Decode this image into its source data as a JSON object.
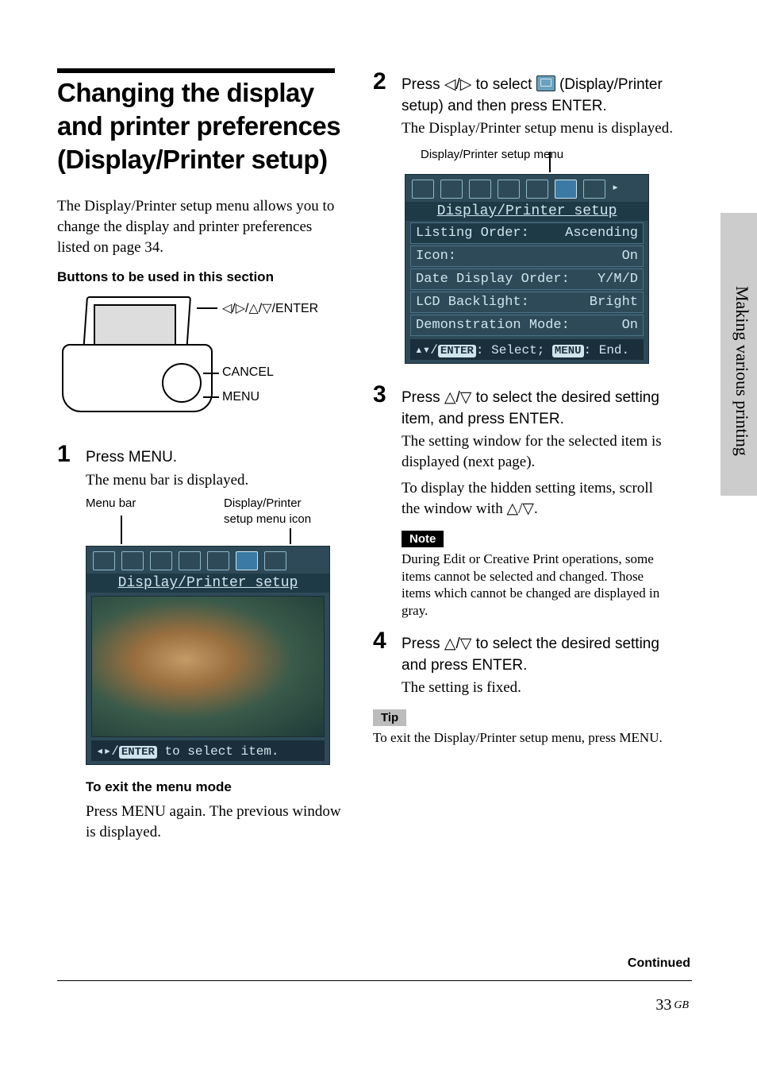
{
  "sideLabel": "Making various printing",
  "title": "Changing the display and printer preferences (Display/Printer setup)",
  "intro": "The Display/Printer setup menu allows you to change the display and printer preferences listed on page 34.",
  "buttonsHeading": "Buttons to be used in this section",
  "deviceLabels": {
    "arrows": "◁/▷/△/▽/ENTER",
    "cancel": "CANCEL",
    "menu": "MENU"
  },
  "step1": {
    "num": "1",
    "lead": "Press MENU.",
    "follow": "The menu bar is displayed.",
    "labelMenuBar": "Menu bar",
    "labelIcon": "Display/Printer setup menu icon",
    "lcdTitle": "Display/Printer setup",
    "lcdHintPrefix": "◂▸/",
    "lcdHintEnter": "ENTER",
    "lcdHintSuffix": " to select item."
  },
  "exitHeading": "To exit the menu mode",
  "exitBody": "Press MENU again.  The previous window is displayed.",
  "step2": {
    "num": "2",
    "leadA": "Press ◁/▷ to select ",
    "leadB": " (Display/Printer setup) and then press ENTER.",
    "follow": "The Display/Printer setup  menu is displayed.",
    "caption": "Display/Printer setup menu",
    "lcdTitle": "Display/Printer setup",
    "rows": [
      {
        "label": "Listing Order:",
        "value": "Ascending",
        "sel": true
      },
      {
        "label": "Icon:",
        "value": "On",
        "sel": false
      },
      {
        "label": "Date Display Order:",
        "value": "Y/M/D",
        "sel": false
      },
      {
        "label": "LCD Backlight:",
        "value": "Bright",
        "sel": false
      },
      {
        "label": "Demonstration Mode:",
        "value": "On",
        "sel": false
      }
    ],
    "hintA": "▴▾/",
    "hintEnter": "ENTER",
    "hintB": ": Select; ",
    "hintMenu": "MENU",
    "hintC": ": End."
  },
  "step3": {
    "num": "3",
    "lead": "Press △/▽ to select the desired setting item, and press ENTER.",
    "follow1": "The setting window for the selected item is displayed (next page).",
    "follow2": "To display the hidden setting items, scroll the window with △/▽."
  },
  "noteLabel": "Note",
  "noteText": "During Edit or Creative Print operations, some items cannot be selected and changed. Those items which cannot be changed are displayed in gray.",
  "step4": {
    "num": "4",
    "lead": "Press △/▽ to select the desired setting and press ENTER.",
    "follow": "The setting is fixed."
  },
  "tipLabel": "Tip",
  "tipText": "To exit the Display/Printer setup menu, press MENU.",
  "continued": "Continued",
  "pageNumber": "33",
  "pageRegion": "GB"
}
